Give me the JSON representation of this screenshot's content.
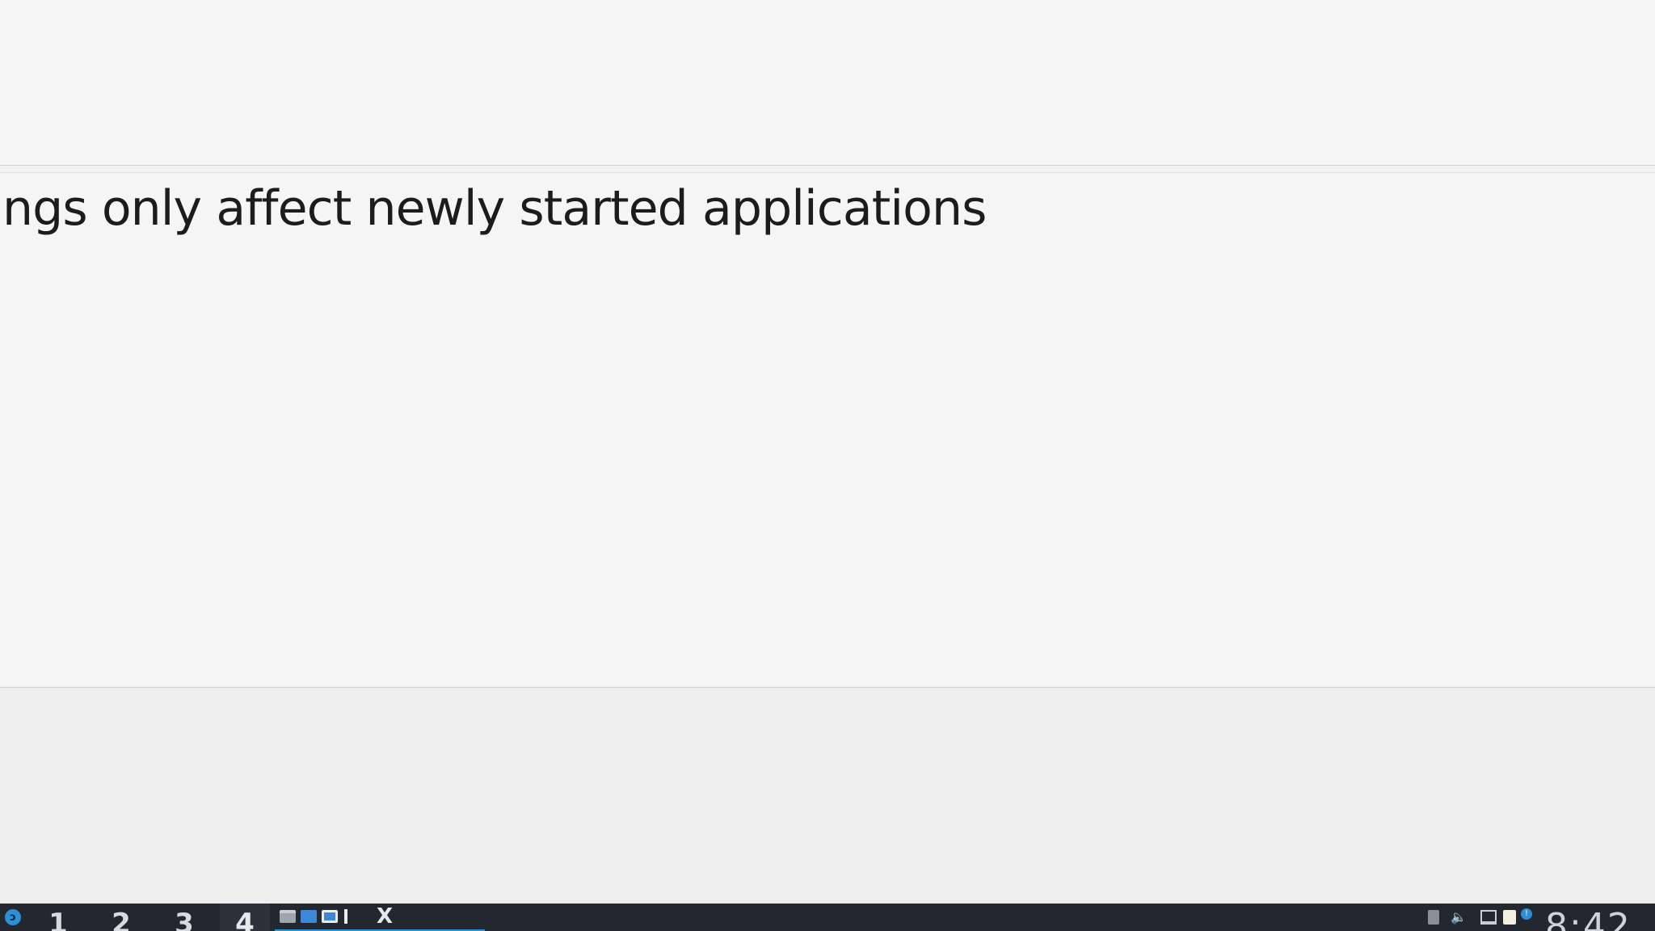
{
  "notice": {
    "text": "ngs only affect newly started applications"
  },
  "taskbar": {
    "start_logo": "ↄ",
    "workspaces": [
      "1",
      "2",
      "3",
      "4"
    ],
    "active_workspace": "4",
    "task_label": "X",
    "volume_glyph": "🔈",
    "update_glyph": "!",
    "clock": "8:42"
  },
  "colors": {
    "background": "#f5f5f5",
    "taskbar": "#232830",
    "accent": "#2d8fd5"
  },
  "icons": [
    "start-menu-icon",
    "file-manager-icon",
    "chat-icon",
    "window-icon",
    "text-cursor-icon",
    "network-icon",
    "volume-icon",
    "display-icon",
    "clipboard-icon",
    "update-icon"
  ]
}
